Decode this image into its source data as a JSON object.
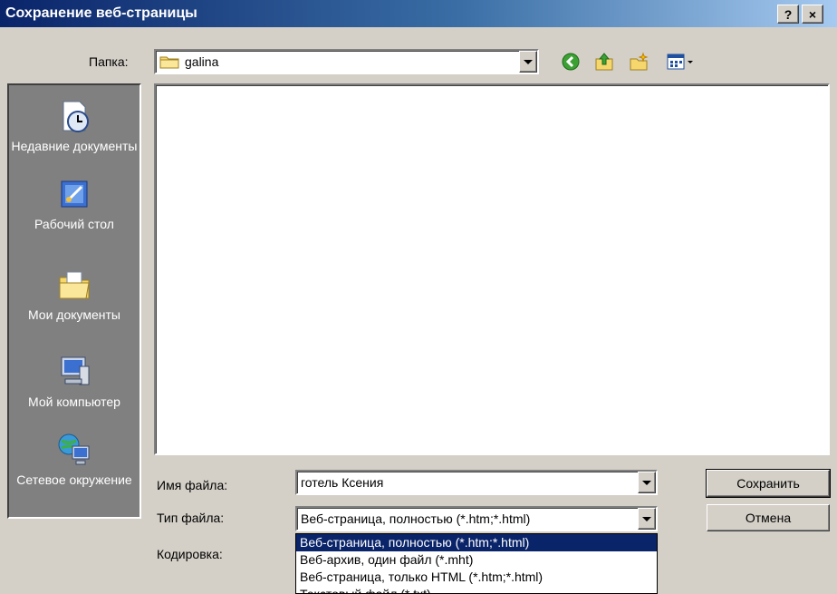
{
  "window": {
    "title": "Сохранение веб-страницы",
    "help_label": "?",
    "close_label": "×"
  },
  "folder": {
    "label": "Папка:",
    "value": "galina"
  },
  "toolbar": {
    "icons": [
      "back-icon",
      "up-folder-icon",
      "new-folder-icon",
      "view-menu-icon"
    ]
  },
  "places": [
    {
      "label": "Недавние документы"
    },
    {
      "label": "Рабочий стол"
    },
    {
      "label": "Мои документы"
    },
    {
      "label": "Мой компьютер"
    },
    {
      "label": "Сетевое окружение"
    }
  ],
  "form": {
    "filename_label": "Имя файла:",
    "filename_value": "готель Ксения",
    "filetype_label": "Тип файла:",
    "filetype_value": "Веб-страница, полностью (*.htm;*.html)",
    "encoding_label": "Кодировка:"
  },
  "buttons": {
    "save": "Сохранить",
    "cancel": "Отмена"
  },
  "filetype_options": [
    "Веб-страница, полностью (*.htm;*.html)",
    "Веб-архив, один файл  (*.mht)",
    "Веб-страница, только HTML (*.htm;*.html)",
    "Текстовый файл (*.txt)"
  ],
  "colors": {
    "title_active": "#0a246a",
    "places_bg": "#808080",
    "selection": "#0a246a",
    "face": "#d4d0c8"
  }
}
